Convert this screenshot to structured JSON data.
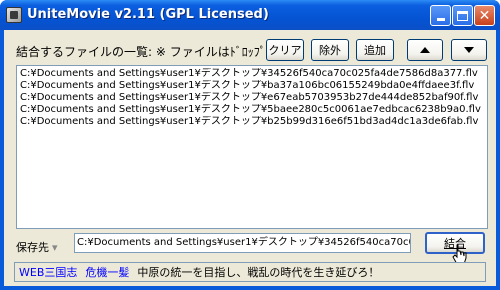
{
  "window": {
    "title": "UniteMovie v2.11 (GPL Licensed)"
  },
  "toolbar": {
    "list_caption": "結合するファイルの一覧: ※ ファイルはﾄﾞﾛｯﾌﾟで追加",
    "clear_label": "クリア",
    "remove_label": "除外",
    "add_label": "追加"
  },
  "files": [
    "C:¥Documents and Settings¥user1¥デスクトップ¥34526f540ca70c025fa4de7586d8a377.flv",
    "C:¥Documents and Settings¥user1¥デスクトップ¥ba37a106bc06155249bda0e4ffdaee3f.flv",
    "C:¥Documents and Settings¥user1¥デスクトップ¥e67eab5703953b27de444de852baf90f.flv",
    "C:¥Documents and Settings¥user1¥デスクトップ¥5baee280c5c0061ae7edbcac6238b9a0.flv",
    "C:¥Documents and Settings¥user1¥デスクトップ¥b25b99d316e6f51bd3ad4dc1a3de6fab.flv"
  ],
  "output": {
    "label": "保存先",
    "path": "C:¥Documents and Settings¥user1¥デスクトップ¥34526f540ca70c0",
    "join_label": "結合"
  },
  "status": {
    "link1": "WEB三国志",
    "link2": "危機一髪",
    "text": "中原の統一を目指し、戦乱の時代を生き延びろ！"
  }
}
